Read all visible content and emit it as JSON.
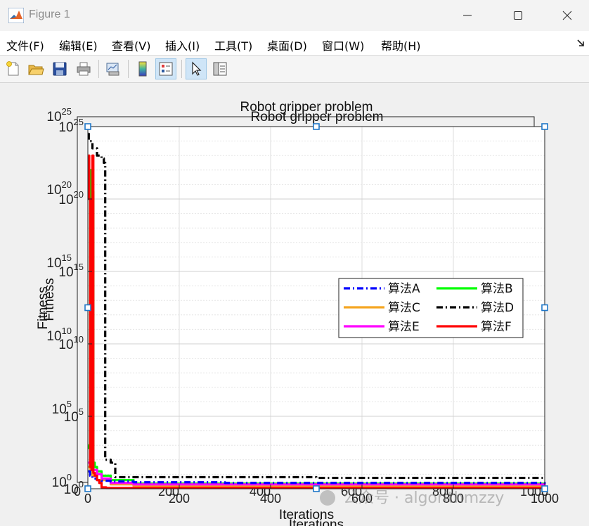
{
  "window": {
    "title": "Figure 1"
  },
  "menu": {
    "items": [
      "文件(F)",
      "编辑(E)",
      "查看(V)",
      "插入(I)",
      "工具(T)",
      "桌面(D)",
      "窗口(W)",
      "帮助(H)"
    ]
  },
  "toolbar": {
    "buttons": [
      "new-figure-icon",
      "open-file-icon",
      "save-icon",
      "print-icon",
      "link-plot-icon",
      "colorbar-icon",
      "legend-icon",
      "pointer-icon",
      "property-inspector-icon"
    ],
    "active": [
      "legend-icon",
      "pointer-icon"
    ]
  },
  "watermark": {
    "text": "公众号 · algorithmzzy"
  },
  "chart_data": [
    {
      "type": "line",
      "title": "Robot gripper problem",
      "xlabel": "Iterations",
      "ylabel": "Fitness",
      "xlim": [
        0,
        1000
      ],
      "ylim_exponent": [
        0,
        25
      ],
      "yscale": "log",
      "xticks": [
        "0",
        "200",
        "400",
        "600",
        "800",
        "1000"
      ],
      "yticks_exponent": [
        "0",
        "5",
        "10",
        "15",
        "20",
        "25"
      ],
      "grid": true,
      "legend_position": "right",
      "legend_columns": 2,
      "series": [
        {
          "name": "算法A",
          "color": "#0000ff",
          "style": "dash-dot",
          "x": [
            1,
            5,
            10,
            20,
            30,
            50,
            100,
            300,
            1000
          ],
          "log10_y": [
            1.2,
            0.9,
            0.7,
            0.6,
            0.55,
            0.5,
            0.45,
            0.4,
            0.35
          ]
        },
        {
          "name": "算法B",
          "color": "#00ff00",
          "style": "solid",
          "x": [
            1,
            3,
            5,
            8,
            10,
            12,
            15,
            20,
            30,
            50,
            100,
            1000
          ],
          "log10_y": [
            3.0,
            2.8,
            22.0,
            2.2,
            20.5,
            1.8,
            1.5,
            1.2,
            0.9,
            0.6,
            0.35,
            0.25
          ]
        },
        {
          "name": "算法C",
          "color": "#f5a623",
          "style": "solid",
          "x": [
            1,
            5,
            10,
            20,
            50,
            100,
            1000
          ],
          "log10_y": [
            1.5,
            1.2,
            0.9,
            0.6,
            0.3,
            0.2,
            0.15
          ]
        },
        {
          "name": "算法D",
          "color": "#000000",
          "style": "dash-dot",
          "x": [
            1,
            2,
            10,
            20,
            30,
            35,
            38,
            45,
            50,
            60,
            100,
            500,
            1000
          ],
          "log10_y": [
            24.5,
            24.0,
            23.5,
            23.0,
            22.8,
            22.5,
            2.0,
            2.0,
            1.8,
            0.8,
            0.8,
            0.75,
            0.7
          ]
        },
        {
          "name": "算法E",
          "color": "#ff00ff",
          "style": "solid",
          "x": [
            1,
            5,
            10,
            20,
            30,
            50,
            100,
            1000
          ],
          "log10_y": [
            1.8,
            1.6,
            1.3,
            1.0,
            0.7,
            0.4,
            0.3,
            0.25
          ]
        },
        {
          "name": "算法F",
          "color": "#ff0000",
          "style": "solid",
          "x": [
            1,
            3,
            5,
            8,
            10,
            12,
            15,
            20,
            25,
            30,
            40,
            100,
            1000
          ],
          "log10_y": [
            23.0,
            20.0,
            1.5,
            1.3,
            23.0,
            1.1,
            0.9,
            0.6,
            0.4,
            0.1,
            0.05,
            0.05,
            0.05
          ]
        }
      ]
    },
    {
      "type": "line",
      "title": "Robot gripper problem",
      "xlabel": "Iterations",
      "ylabel": "Fitness",
      "xticks": [
        "0",
        "200",
        "400",
        "600",
        "800",
        "1000"
      ],
      "yticks_exponent": [
        "0",
        "5",
        "10",
        "15",
        "20",
        "25"
      ]
    }
  ]
}
